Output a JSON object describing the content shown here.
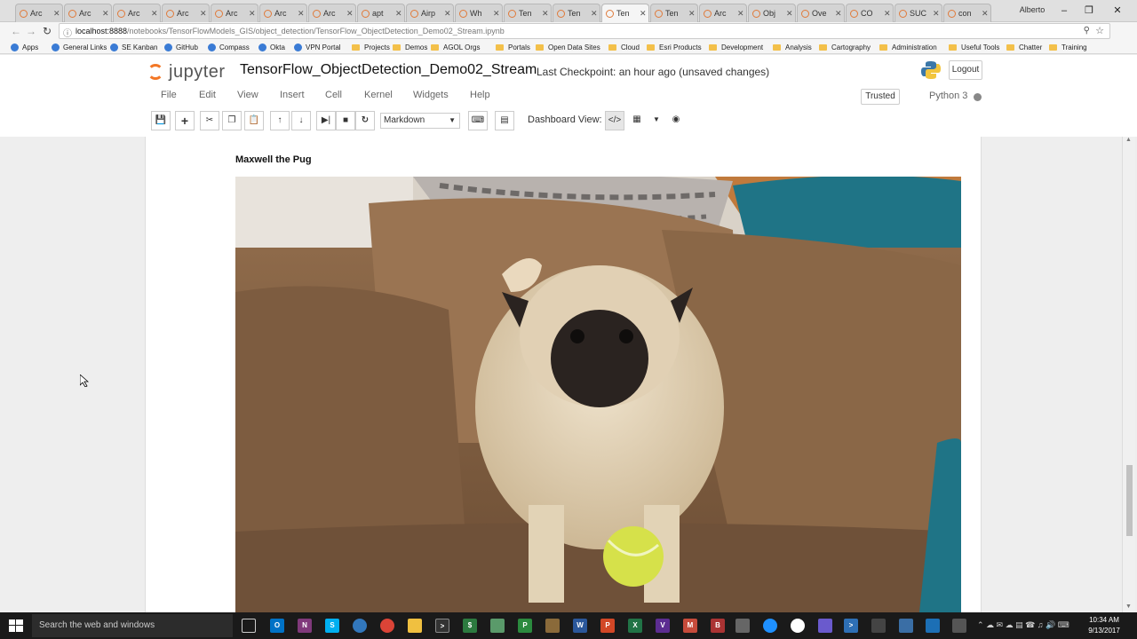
{
  "browser": {
    "tabs": [
      {
        "label": "Arc"
      },
      {
        "label": "Arc"
      },
      {
        "label": "Arc"
      },
      {
        "label": "Arc"
      },
      {
        "label": "Arc"
      },
      {
        "label": "Arc"
      },
      {
        "label": "Arc"
      },
      {
        "label": "apt"
      },
      {
        "label": "Airp"
      },
      {
        "label": "Wh"
      },
      {
        "label": "Ten"
      },
      {
        "label": "Ten"
      },
      {
        "label": "Ten"
      },
      {
        "label": "Ten"
      },
      {
        "label": "Arc"
      },
      {
        "label": "Obj"
      },
      {
        "label": "Ove"
      },
      {
        "label": "CO"
      },
      {
        "label": "SUC"
      },
      {
        "label": "con"
      }
    ],
    "profile": "Alberto",
    "url_host": "localhost:8888",
    "url_path": "/notebooks/TensorFlowModels_GIS/object_detection/TensorFlow_ObjectDetection_Demo02_Stream.ipynb",
    "bookmarks": [
      "Apps",
      "General Links",
      "SE Kanban",
      "GitHub",
      "Compass",
      "Okta",
      "VPN Portal",
      "Projects",
      "Demos",
      "AGOL Orgs",
      "Portals",
      "Open Data Sites",
      "Cloud",
      "Esri Products",
      "Development",
      "Analysis",
      "Cartography",
      "Administration",
      "Useful Tools",
      "Chatter",
      "Training"
    ]
  },
  "jupyter": {
    "logo_text": "jupyter",
    "notebook_title": "TensorFlow_ObjectDetection_Demo02_Stream",
    "checkpoint": "Last Checkpoint: an hour ago (unsaved changes)",
    "logout": "Logout",
    "menus": [
      "File",
      "Edit",
      "View",
      "Insert",
      "Cell",
      "Kernel",
      "Widgets",
      "Help"
    ],
    "trusted": "Trusted",
    "kernel": "Python 3",
    "cell_type": "Markdown",
    "dashboard_label": "Dashboard View:"
  },
  "content": {
    "heading": "Maxwell the Pug"
  },
  "taskbar": {
    "search_placeholder": "Search the web and windows",
    "time": "10:34 AM",
    "date": "9/13/2017"
  }
}
